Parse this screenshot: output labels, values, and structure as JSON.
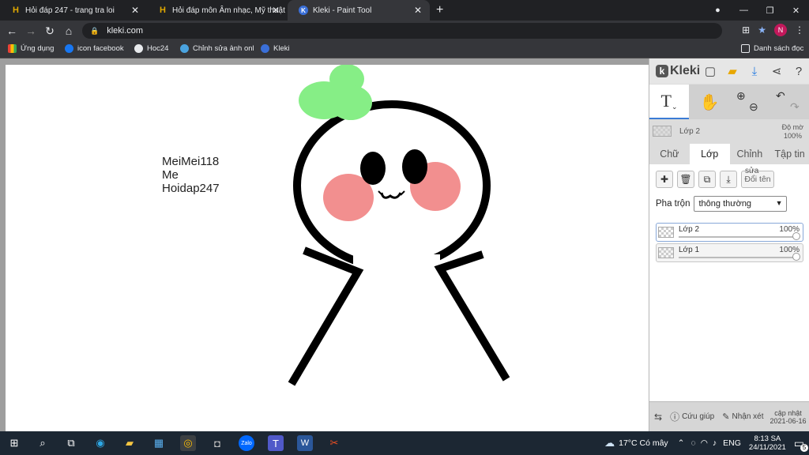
{
  "browser": {
    "tabs": [
      {
        "title": "Hỏi đáp 247 - trang tra loi",
        "favicon": "H"
      },
      {
        "title": "Hỏi đáp môn Âm nhạc, Mỹ thuật",
        "favicon": "H"
      },
      {
        "title": "Kleki - Paint Tool",
        "favicon": "K"
      }
    ],
    "url": "kleki.com",
    "profile_initial": "N",
    "bookmarks": [
      "Ứng dụng",
      "icon facebook",
      "Hoc24",
      "Chỉnh sửa ảnh onl",
      "Kleki"
    ],
    "reading_list": "Danh sách đọc"
  },
  "canvas": {
    "text_lines": [
      "MeiMei118",
      "Me",
      "Hoidap247"
    ]
  },
  "kleki": {
    "logo": "Kleki",
    "current_layer": "Lớp 2",
    "opacity_label": "Độ mờ",
    "opacity_value": "100%",
    "tabs": [
      "Chữ",
      "Lớp",
      "Chỉnh",
      "Tập tin"
    ],
    "active_tab": "Lớp",
    "rename_label": "Đổi tên",
    "rename_overlay": "sửa",
    "blend_label": "Pha trộn",
    "blend_value": "thông thường",
    "layers": [
      {
        "name": "Lớp 2",
        "opacity": "100%"
      },
      {
        "name": "Lớp 1",
        "opacity": "100%"
      }
    ],
    "help_label": "Cứu giúp",
    "feedback_label": "Nhận xét",
    "update_label": "cập nhật",
    "update_date": "2021-06-16"
  },
  "taskbar": {
    "weather": "17°C  Có mây",
    "lang": "ENG",
    "time": "8:13 SA",
    "date": "24/11/2021",
    "notifications": "5"
  },
  "colors": {
    "accent": "#3a7bd5",
    "leaf": "#86ee86",
    "blush": "#f07b7b"
  }
}
